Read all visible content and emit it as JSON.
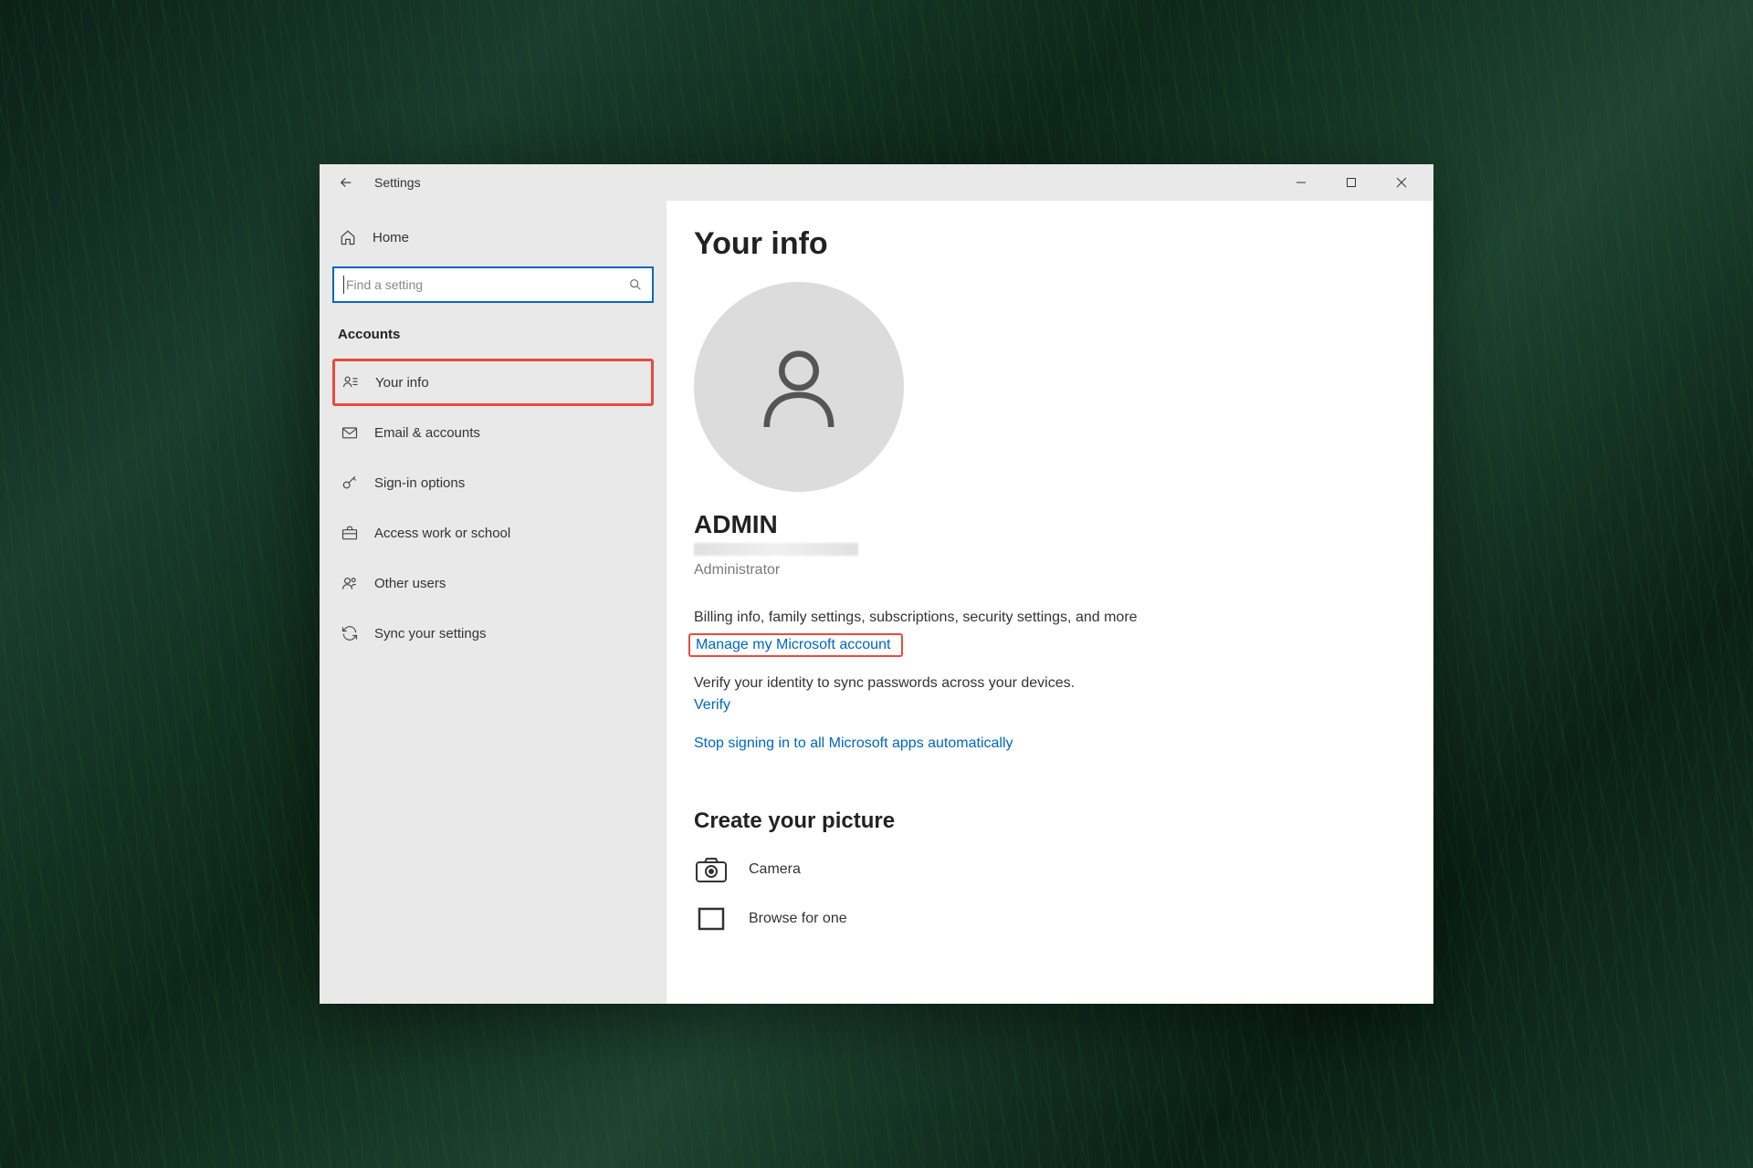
{
  "window": {
    "title": "Settings"
  },
  "sidebar": {
    "home_label": "Home",
    "search_placeholder": "Find a setting",
    "section_label": "Accounts",
    "items": [
      {
        "label": "Your info",
        "icon": "person-card-icon",
        "highlighted": true
      },
      {
        "label": "Email & accounts",
        "icon": "mail-icon",
        "highlighted": false
      },
      {
        "label": "Sign-in options",
        "icon": "key-icon",
        "highlighted": false
      },
      {
        "label": "Access work or school",
        "icon": "briefcase-icon",
        "highlighted": false
      },
      {
        "label": "Other users",
        "icon": "other-users-icon",
        "highlighted": false
      },
      {
        "label": "Sync your settings",
        "icon": "sync-icon",
        "highlighted": false
      }
    ]
  },
  "content": {
    "heading": "Your info",
    "username": "ADMIN",
    "role": "Administrator",
    "billing_text": "Billing info, family settings, subscriptions, security settings, and more",
    "manage_link": "Manage my Microsoft account",
    "verify_text": "Verify your identity to sync passwords across your devices.",
    "verify_link": "Verify",
    "stop_signin_link": "Stop signing in to all Microsoft apps automatically",
    "create_picture_heading": "Create your picture",
    "camera_label": "Camera",
    "browse_label": "Browse for one"
  }
}
